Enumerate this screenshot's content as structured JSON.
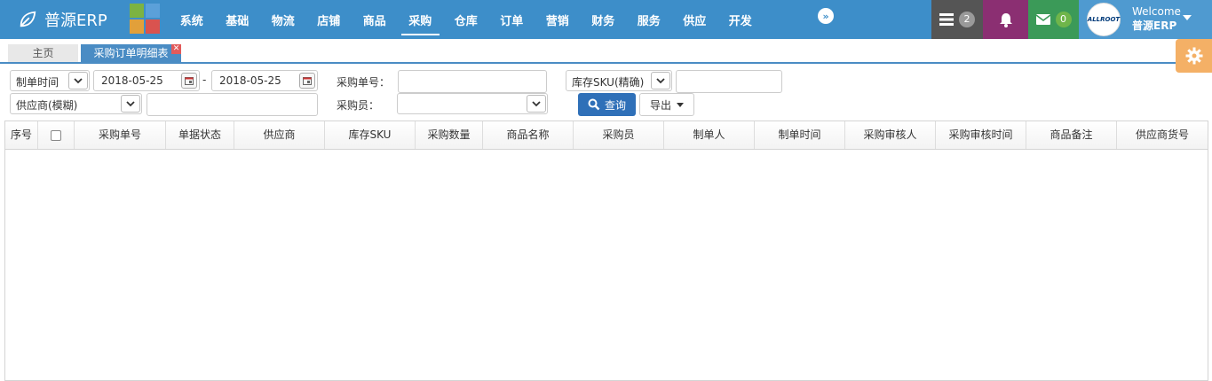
{
  "brand": {
    "title": "普源ERP"
  },
  "menu": [
    {
      "label": "系统"
    },
    {
      "label": "基础"
    },
    {
      "label": "物流"
    },
    {
      "label": "店铺"
    },
    {
      "label": "商品"
    },
    {
      "label": "采购"
    },
    {
      "label": "仓库"
    },
    {
      "label": "订单"
    },
    {
      "label": "营销"
    },
    {
      "label": "财务"
    },
    {
      "label": "服务"
    },
    {
      "label": "供应"
    },
    {
      "label": "开发"
    }
  ],
  "menu_active": "采购",
  "notifications": {
    "tasks_count": "2",
    "mail_count": "0"
  },
  "user": {
    "welcome": "Welcome",
    "name": "普源ERP",
    "avatar_text": "ALLROOT"
  },
  "tabs": {
    "home": "主页",
    "active": "采购订单明细表"
  },
  "filters": {
    "date_type": "制单时间",
    "date_from": "2018-05-25",
    "date_sep": "-",
    "date_to": "2018-05-25",
    "order_no_label": "采购单号：",
    "order_no_value": "",
    "sku_mode": "库存SKU(精确)",
    "sku_value": "",
    "supplier_mode": "供应商(模糊)",
    "supplier_value": "",
    "buyer_label": "采购员：",
    "buyer_value": "",
    "query_label": "查询",
    "export_label": "导出"
  },
  "grid": {
    "columns": [
      "序号",
      "",
      "采购单号",
      "单据状态",
      "供应商",
      "库存SKU",
      "采购数量",
      "商品名称",
      "采购员",
      "制单人",
      "制单时间",
      "采购审核人",
      "采购审核时间",
      "商品备注",
      "供应商货号"
    ],
    "rows": []
  }
}
